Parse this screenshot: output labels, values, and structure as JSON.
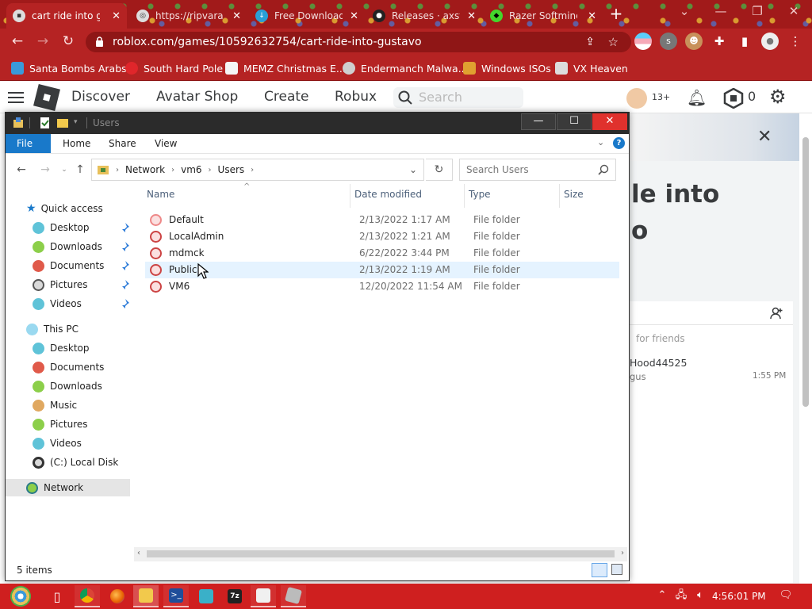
{
  "browser": {
    "tabs": [
      {
        "label": "cart ride into gu",
        "active": true
      },
      {
        "label": "https://ripvara",
        "active": false
      },
      {
        "label": "Free Download",
        "active": false
      },
      {
        "label": "Releases · axst",
        "active": false
      },
      {
        "label": "Razer Softmine",
        "active": false
      }
    ],
    "url": "roblox.com/games/10592632754/cart-ride-into-gustavo",
    "bookmarks": [
      "Santa Bombs Arabs",
      "South Hard Pole",
      "MEMZ Christmas E...",
      "Endermanch Malwa...",
      "Windows ISOs",
      "VX Heaven"
    ],
    "accent": "#b52323"
  },
  "roblox": {
    "nav": [
      "Discover",
      "Avatar Shop",
      "Create",
      "Robux"
    ],
    "search_placeholder": "Search",
    "age_badge": "13+",
    "robux_count": "0",
    "title_line1": "le into",
    "title_line2": "o",
    "friends_hint": "for friends",
    "chat_user": "Hood44525",
    "chat_sub": "gus",
    "chat_time": "1:55 PM"
  },
  "explorer": {
    "title": "Users",
    "ribbon_tabs": [
      "File",
      "Home",
      "Share",
      "View"
    ],
    "breadcrumb": [
      "Network",
      "vm6",
      "Users"
    ],
    "search_placeholder": "Search Users",
    "columns": {
      "name": "Name",
      "date": "Date modified",
      "type": "Type",
      "size": "Size"
    },
    "nav": {
      "quick_access": "Quick access",
      "quick_items": [
        "Desktop",
        "Downloads",
        "Documents",
        "Pictures",
        "Videos"
      ],
      "this_pc": "This PC",
      "pc_items": [
        "Desktop",
        "Documents",
        "Downloads",
        "Music",
        "Pictures",
        "Videos",
        "(C:) Local Disk"
      ],
      "network": "Network"
    },
    "files": [
      {
        "name": "Default",
        "date": "2/13/2022 1:17 AM",
        "type": "File folder"
      },
      {
        "name": "LocalAdmin",
        "date": "2/13/2022 1:21 AM",
        "type": "File folder"
      },
      {
        "name": "mdmck",
        "date": "6/22/2022 3:44 PM",
        "type": "File folder"
      },
      {
        "name": "Public",
        "date": "2/13/2022 1:19 AM",
        "type": "File folder"
      },
      {
        "name": "VM6",
        "date": "12/20/2022 11:54 AM",
        "type": "File folder"
      }
    ],
    "status": "5 items"
  },
  "taskbar": {
    "clock": "4:56:01 PM",
    "color": "#cf1f1f"
  }
}
